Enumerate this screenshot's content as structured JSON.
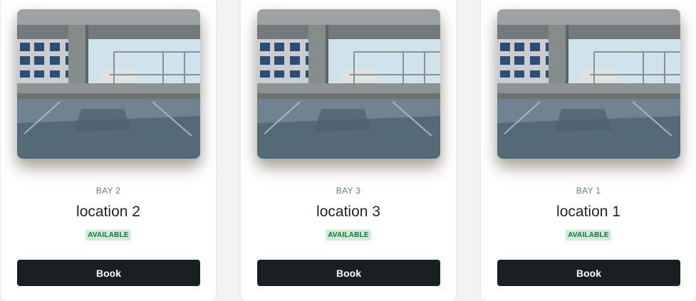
{
  "spots": [
    {
      "bay": "BAY 2",
      "location": "location 2",
      "status": "AVAILABLE",
      "button": "Book"
    },
    {
      "bay": "BAY 3",
      "location": "location 3",
      "status": "AVAILABLE",
      "button": "Book"
    },
    {
      "bay": "BAY 1",
      "location": "location 1",
      "status": "AVAILABLE",
      "button": "Book"
    }
  ],
  "colors": {
    "badge_bg": "#cdeed8",
    "badge_text": "#1f6b3a",
    "button_bg": "#182023"
  }
}
